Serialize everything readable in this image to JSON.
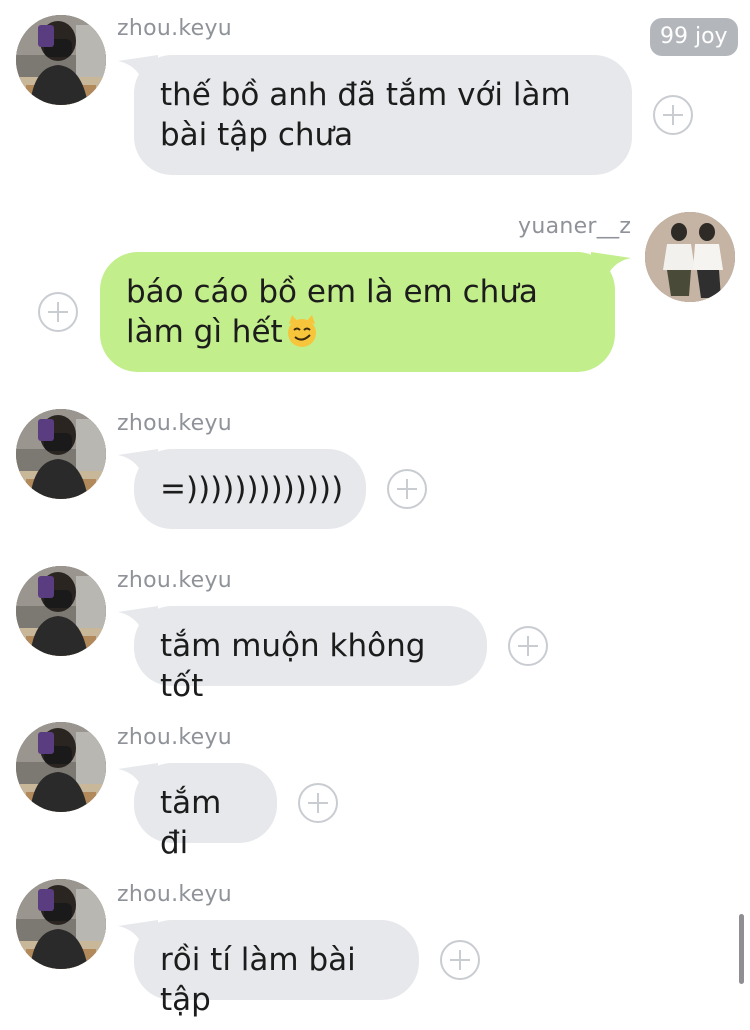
{
  "badge": {
    "label": "99 joy"
  },
  "messages": [
    {
      "sender": "zhou.keyu",
      "direction": "incoming",
      "text": "thế bồ anh đã tắm với làm bài tập chưa"
    },
    {
      "sender": "yuaner__z",
      "direction": "outgoing",
      "text": "báo cáo bồ em là em chưa làm gì hết",
      "emoji": "smirking-cat-emoji"
    },
    {
      "sender": "zhou.keyu",
      "direction": "incoming",
      "text": "=)))))))))))))"
    },
    {
      "sender": "zhou.keyu",
      "direction": "incoming",
      "text": "tắm muộn không tốt"
    },
    {
      "sender": "zhou.keyu",
      "direction": "incoming",
      "text": "tắm đi"
    },
    {
      "sender": "zhou.keyu",
      "direction": "incoming",
      "text": "rồi tí làm bài tập"
    }
  ],
  "colors": {
    "incoming_bubble": "#e6e8eb",
    "outgoing_bubble": "#c3ee8c",
    "name_text": "#8f9399",
    "badge_bg": "#b3b6bb"
  }
}
